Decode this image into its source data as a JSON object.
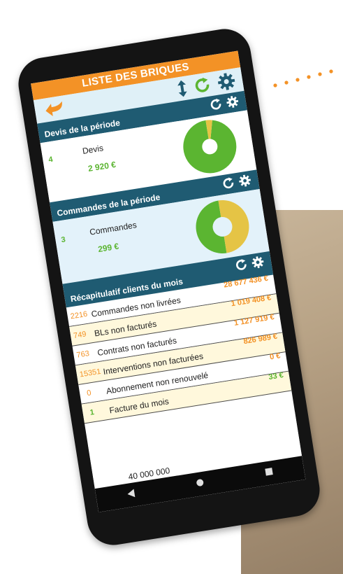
{
  "app": {
    "title": "LISTE DES BRIQUES"
  },
  "toolbar": {
    "icons": [
      "back-arrow-icon",
      "sort-arrows-icon",
      "refresh-icon",
      "gear-icon"
    ]
  },
  "devis": {
    "title": "Devis de la période",
    "count": "4",
    "label": "Devis",
    "amount": "2 920 €",
    "donut": {
      "green": 0.96,
      "yellow": 0.04
    }
  },
  "commandes": {
    "title": "Commandes de la période",
    "count": "3",
    "label": "Commandes",
    "amount": "299 €",
    "donut": {
      "green": 0.5,
      "yellow": 0.5
    }
  },
  "recap": {
    "title": "Récapitulatif clients du mois",
    "rows": [
      {
        "count": "2216",
        "label": "Commandes non livrées",
        "value": "28 677 436 €"
      },
      {
        "count": "749",
        "label": "BLs non facturés",
        "value": "1 019 408 €"
      },
      {
        "count": "763",
        "label": "Contrats non facturés",
        "value": "1 127 919 €"
      },
      {
        "count": "15351",
        "label": "Interventions non facturées",
        "value": "826 989 €"
      },
      {
        "count": "0",
        "label": "Abonnement non renouvelé",
        "value": "0 €"
      },
      {
        "count": "1",
        "label": "Facture du mois",
        "value": "33 €"
      }
    ],
    "partial": "40 000 000"
  },
  "colors": {
    "orange": "#f39226",
    "teal": "#1f5b72",
    "green": "#5bb531",
    "yellow": "#e5c445",
    "light_blue": "#dff0f7"
  }
}
